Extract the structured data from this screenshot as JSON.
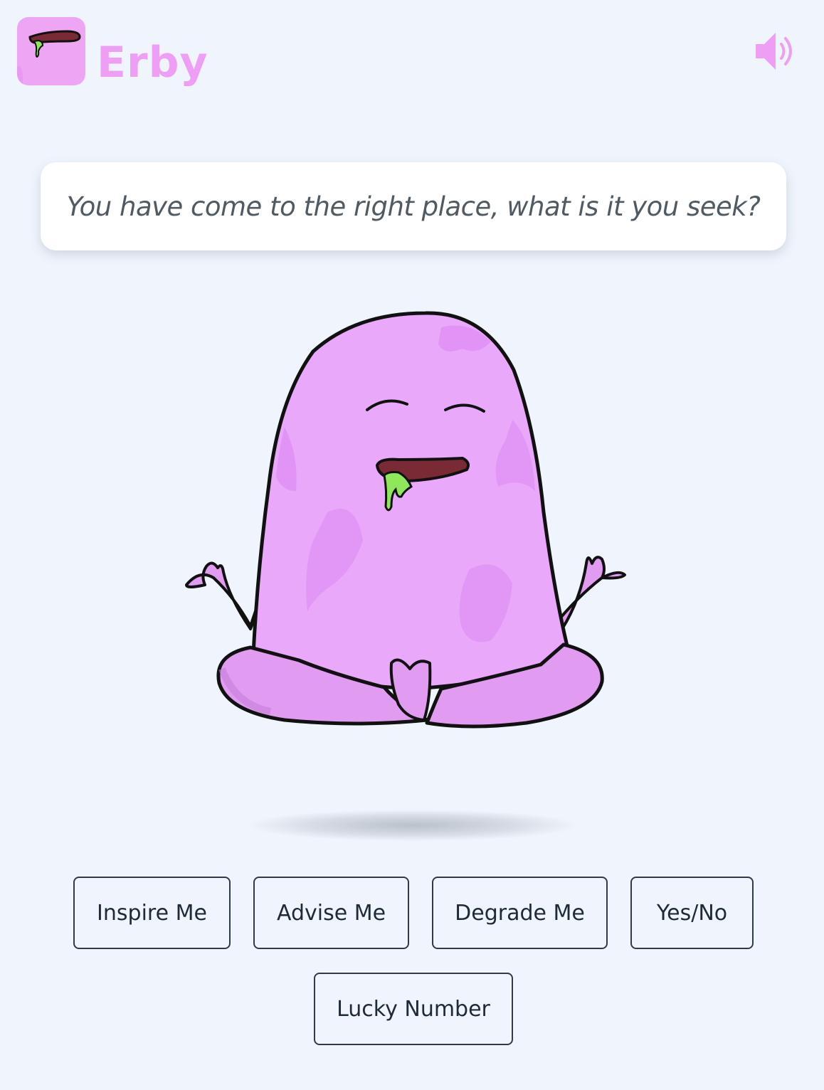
{
  "header": {
    "app_name": "Erby",
    "logo_icon": "erby-mouth-icon",
    "sound_icon": "speaker-volume-icon"
  },
  "speech": {
    "text": "You have come to the right place, what is it you seek?"
  },
  "mascot": {
    "icon": "erby-meditating-creature"
  },
  "actions": {
    "inspire": "Inspire Me",
    "advise": "Advise Me",
    "degrade": "Degrade Me",
    "yes_no": "Yes/No",
    "lucky_number": "Lucky Number"
  },
  "colors": {
    "background": "#f0f5fd",
    "brand_pink": "#ee9ef4",
    "body_pink": "#eaa8fb",
    "mouth": "#7a2a34",
    "slime_green": "#8ee85a",
    "button_border": "#2f3a46",
    "text_dark": "#1e2a36"
  }
}
